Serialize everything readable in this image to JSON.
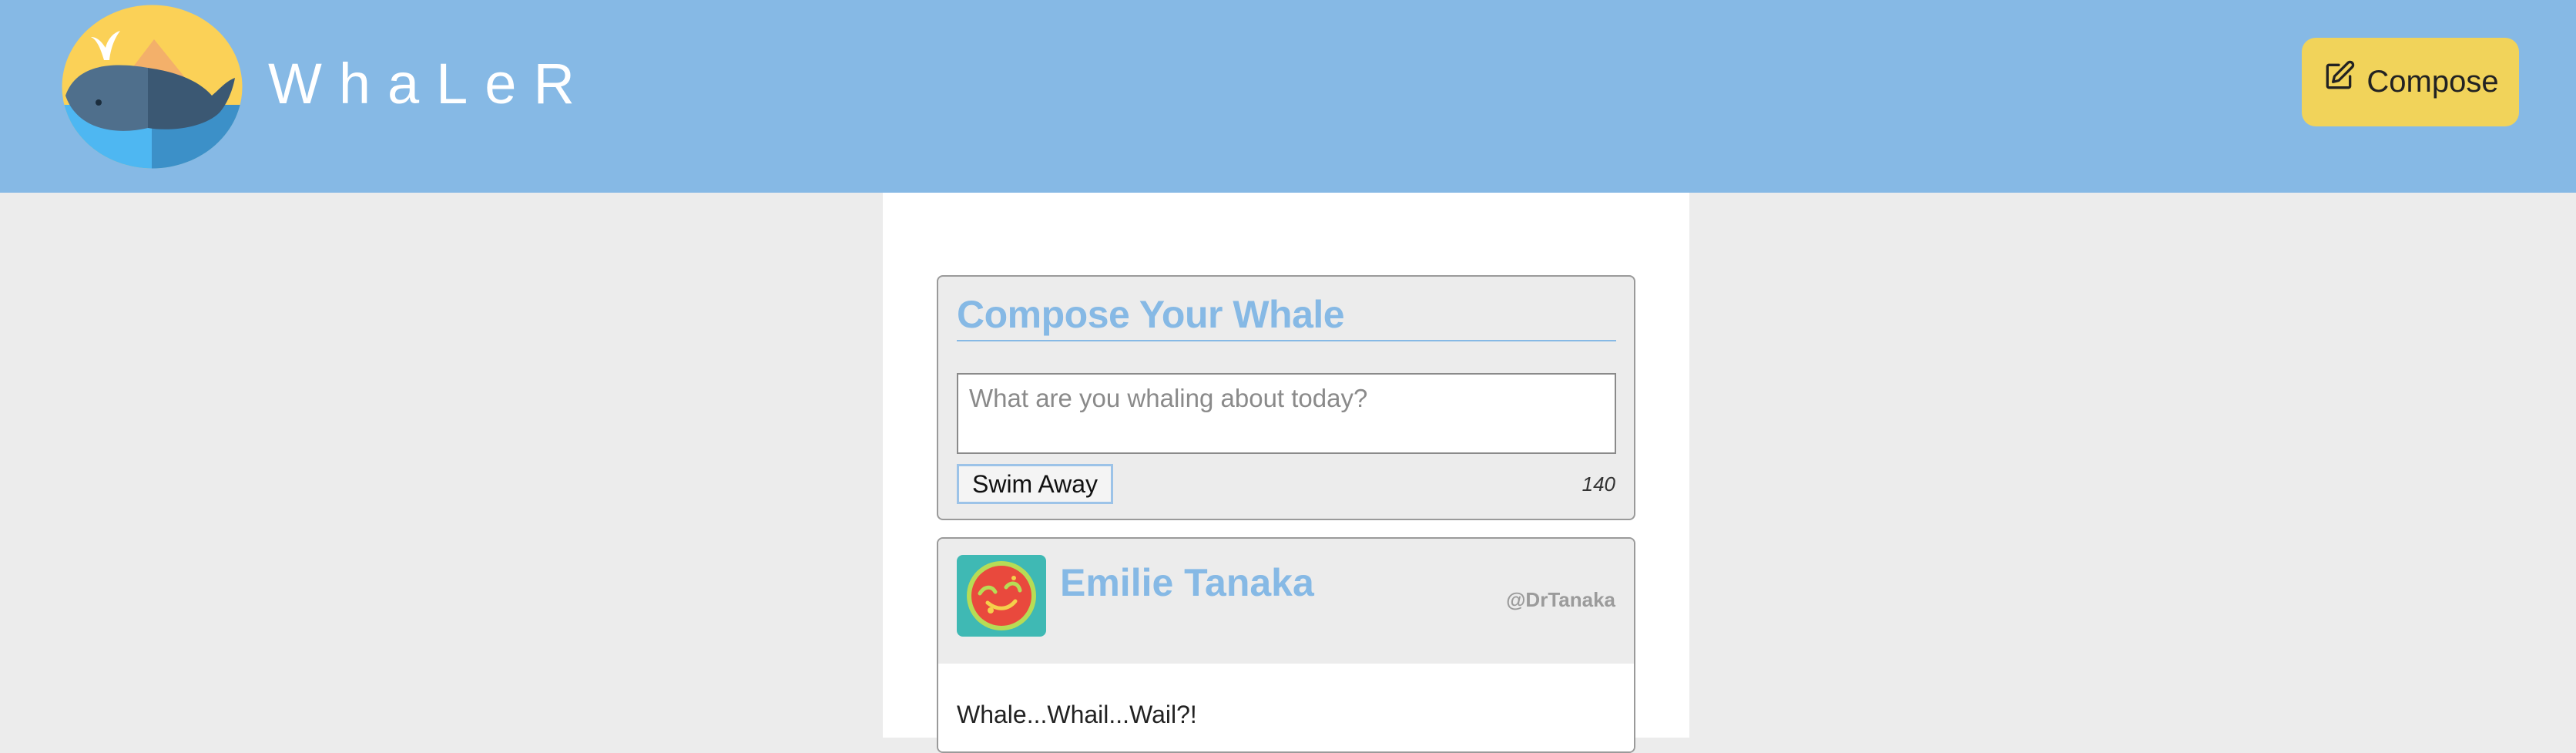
{
  "header": {
    "brand": "WhaLeR",
    "compose_label": "Compose",
    "logo_icon": "whale-logo-icon",
    "compose_icon": "edit-icon"
  },
  "composer": {
    "title": "Compose Your Whale",
    "placeholder": "What are you whaling about today?",
    "value": "",
    "submit_label": "Swim Away",
    "char_count": "140"
  },
  "feed": [
    {
      "author": "Emilie Tanaka",
      "handle": "@DrTanaka",
      "text": "Whale...Whail...Wail?!",
      "avatar_icon": "avatar-icon"
    }
  ],
  "colors": {
    "header_bg": "#86b9e5",
    "accent": "#86b9e5",
    "compose_button": "#f1d35a",
    "page_bg": "#ececec"
  }
}
